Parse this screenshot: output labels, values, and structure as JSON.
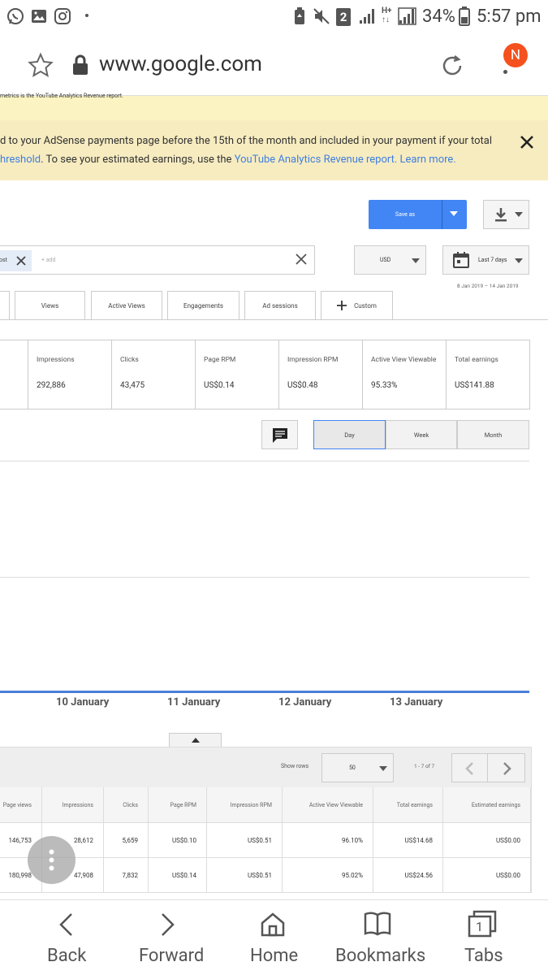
{
  "status_bar": {
    "battery": "34%",
    "time": "5:57 pm",
    "sim": "2",
    "avatar_letter": "N"
  },
  "browser": {
    "url": "www.google.com"
  },
  "banner": {
    "top_snippet": "metrics is the YouTube Analytics Revenue report.",
    "line1": "d to your AdSense payments page before the 15th of the month and included in your payment if your total",
    "line2_a": "hreshold",
    "line2_b": ". To see your estimated earnings, use the ",
    "line2_link1": "YouTube Analytics Revenue report.",
    "line2_link2": "Learn more."
  },
  "toolbar": {
    "save_as": "Save as"
  },
  "filter": {
    "chip_label": "ost",
    "add_placeholder": "+ add",
    "currency": "USD",
    "date_range": "Last 7 days",
    "date_span": "8 Jan 2019 – 14 Jan 2019"
  },
  "tabs": [
    "Views",
    "Active Views",
    "Engagements",
    "Ad sessions",
    "Custom"
  ],
  "cards": [
    {
      "label": "Impressions",
      "value": "292,886"
    },
    {
      "label": "Clicks",
      "value": "43,475"
    },
    {
      "label": "Page RPM",
      "value": "US$0.14"
    },
    {
      "label": "Impression RPM",
      "value": "US$0.48"
    },
    {
      "label": "Active View Viewable",
      "value": "95.33%"
    },
    {
      "label": "Total earnings",
      "value": "US$141.88"
    }
  ],
  "granularity": [
    "Day",
    "Week",
    "Month"
  ],
  "chart_axis": [
    "10 January",
    "11 January",
    "12 January",
    "13 January"
  ],
  "table": {
    "show_rows_label": "Show rows",
    "rows_value": "50",
    "page_info": "1 - 7 of 7",
    "headers": [
      "Page views",
      "Impressions",
      "Clicks",
      "Page RPM",
      "Impression RPM",
      "Active View Viewable",
      "Total earnings",
      "Estimated earnings"
    ],
    "rows": [
      [
        "146,753",
        "28,612",
        "5,659",
        "US$0.10",
        "US$0.51",
        "96.10%",
        "US$14.68",
        "US$0.00"
      ],
      [
        "180,998",
        "47,908",
        "7,832",
        "US$0.14",
        "US$0.51",
        "95.02%",
        "US$24.56",
        "US$0.00"
      ]
    ]
  },
  "bottom_nav": [
    "Back",
    "Forward",
    "Home",
    "Bookmarks",
    "Tabs"
  ],
  "tabs_count": "1",
  "colors": {
    "accent": "#4285f4",
    "banner": "#fbf4c2",
    "avatar": "#f4511e"
  }
}
